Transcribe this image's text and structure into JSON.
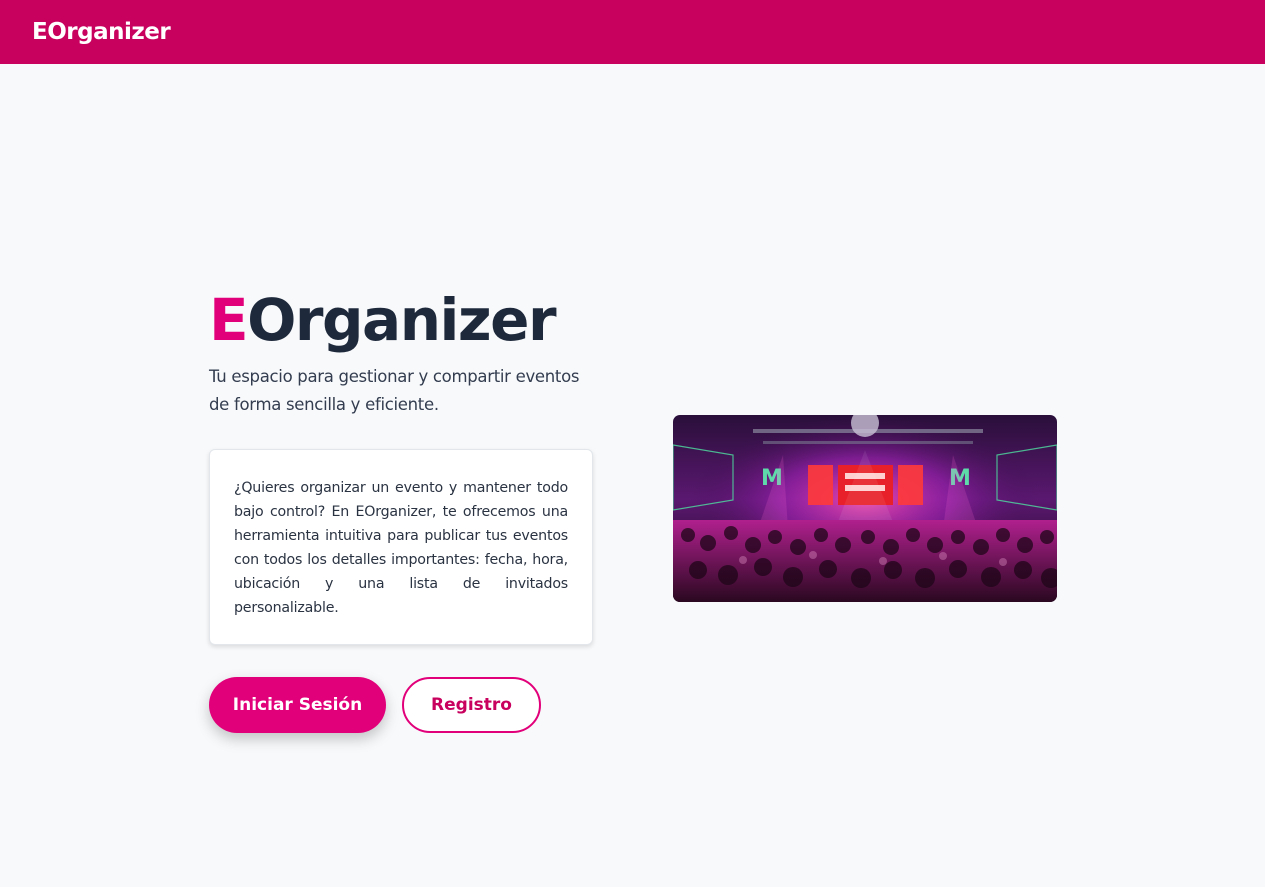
{
  "navbar": {
    "brand": "EOrganizer"
  },
  "hero": {
    "title_accent": "E",
    "title_rest": "Organizer",
    "subtitle": "Tu espacio para gestionar y compartir eventos de forma sencilla y eficiente.",
    "description": "¿Quieres organizar un evento y mantener todo bajo control? En EOrganizer, te ofrecemos una herramienta intuitiva para publicar tus eventos con todos los detalles importantes: fecha, hora, ubicación y una lista de invitados personalizable."
  },
  "actions": {
    "login_label": "Iniciar Sesión",
    "register_label": "Registro"
  },
  "colors": {
    "brand": "#c8005e",
    "accent": "#e2007a",
    "background": "#f7f9fb",
    "text_dark": "#1e293b"
  }
}
